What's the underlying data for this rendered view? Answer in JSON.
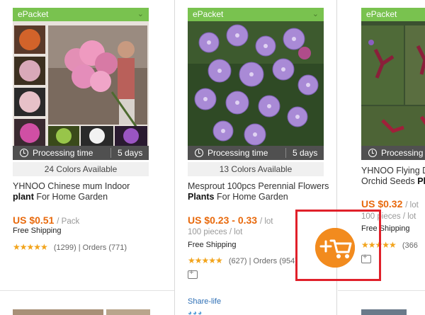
{
  "cards": [
    {
      "shipping_badge": "ePacket",
      "processing_label": "Processing time",
      "processing_days": "5 days",
      "colors_available": "24 Colors Available",
      "title_pre": "YHNOO Chinese mum Indoor",
      "title_bold": "plant",
      "title_post": " For Home Garden",
      "price": "US $0.51",
      "price_unit": "/ Pack",
      "shipping": "Free Shipping",
      "stars": "★★★★★",
      "reviews": "(1299)",
      "separator": "|",
      "orders": "Orders (771)"
    },
    {
      "shipping_badge": "ePacket",
      "processing_label": "Processing time",
      "processing_days": "5 days",
      "colors_available": "13 Colors Available",
      "title_pre": "Mesprout 100pcs Perennial Flowers ",
      "title_bold": "Plants",
      "title_post": " For Home Garden",
      "price": "US $0.23 - 0.33",
      "price_unit": "/ lot",
      "pieces": "100 pieces / lot",
      "shipping": "Free Shipping",
      "stars": "★★★★★",
      "reviews": "(627)",
      "separator": "|",
      "orders": "Orders (954)",
      "share_label": "Share-life",
      "share_icons": "◕◕◕"
    },
    {
      "shipping_badge": "ePacket",
      "processing_label": "Processing time",
      "title_pre": "YHNOO Flying D",
      "title_line2_pre": "Orchid Seeds ",
      "title_bold": "Pl",
      "price": "US $0.32",
      "price_unit": "/ lot",
      "pieces": "100 pieces / lot",
      "shipping": "Free Shipping",
      "stars": "★★★★★",
      "reviews": "(366"
    }
  ],
  "colors": {
    "epacket_green": "#79c24f",
    "price_orange": "#e8690c",
    "star_gold": "#f2a41c",
    "cart_orange": "#f28b1e",
    "highlight_red": "#e0202a"
  },
  "icons": {
    "cart_button": "add-to-cart-icon",
    "clock": "clock-icon",
    "compare": "compare-icon",
    "chevron": "chevron-down-icon"
  }
}
